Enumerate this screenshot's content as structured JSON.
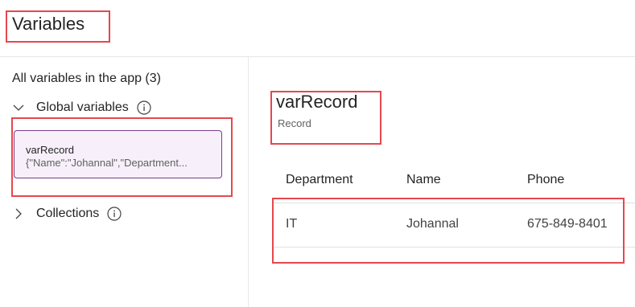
{
  "header": {
    "title": "Variables"
  },
  "sidebar": {
    "heading": "All variables in the app (3)",
    "groups": [
      {
        "label": "Global variables",
        "expanded": true
      },
      {
        "label": "Collections",
        "expanded": false
      }
    ],
    "selected_variable": {
      "name": "varRecord",
      "value_preview": "{\"Name\":\"Johannal\",\"Department..."
    }
  },
  "detail": {
    "name": "varRecord",
    "type": "Record",
    "table": {
      "columns": [
        "Department",
        "Name",
        "Phone"
      ],
      "rows": [
        [
          "IT",
          "Johannal",
          "675-849-8401"
        ]
      ]
    }
  },
  "colors": {
    "highlight": "#e5484d",
    "card_bg": "#f7f0fa",
    "card_border": "#7a3d8c",
    "divider": "#e6e6e6"
  },
  "icons": [
    "chevron-down-icon",
    "chevron-right-icon",
    "info-icon"
  ]
}
